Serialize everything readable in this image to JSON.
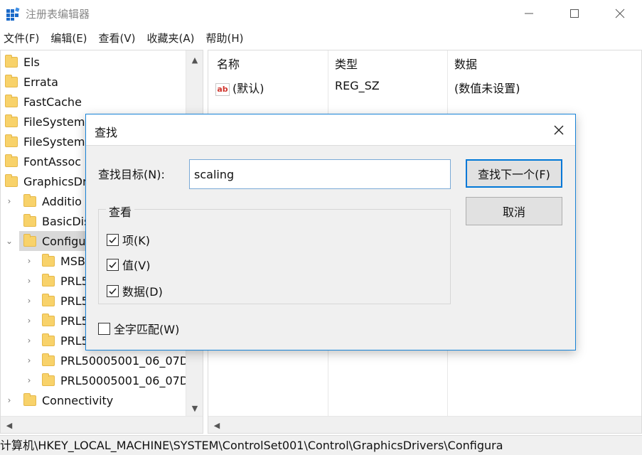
{
  "app": {
    "title": "注册表编辑器"
  },
  "menu": [
    "文件(F)",
    "编辑(E)",
    "查看(V)",
    "收藏夹(A)",
    "帮助(H)"
  ],
  "tree": {
    "items": [
      {
        "label": "Els"
      },
      {
        "label": "Errata"
      },
      {
        "label": "FastCache"
      },
      {
        "label": "FileSystem"
      },
      {
        "label": "FileSystemU"
      },
      {
        "label": "FontAssoc"
      },
      {
        "label": "GraphicsDr"
      },
      {
        "label": "Additio"
      },
      {
        "label": "BasicDis"
      },
      {
        "label": "Configu"
      },
      {
        "label": "MSBD"
      },
      {
        "label": "PRL5"
      },
      {
        "label": "PRL5"
      },
      {
        "label": "PRL5"
      },
      {
        "label": "PRL5"
      },
      {
        "label": "PRL50005001_06_07D"
      },
      {
        "label": "PRL50005001_06_07D"
      },
      {
        "label": "Connectivity"
      }
    ]
  },
  "list": {
    "columns": [
      "名称",
      "类型",
      "数据"
    ],
    "rows": [
      {
        "name": "(默认)",
        "type": "REG_SZ",
        "data": "(数值未设置)"
      }
    ]
  },
  "status": {
    "path": "计算机\\HKEY_LOCAL_MACHINE\\SYSTEM\\ControlSet001\\Control\\GraphicsDrivers\\Configura"
  },
  "find_dialog": {
    "title": "查找",
    "target_label": "查找目标(N):",
    "target_value": "scaling",
    "find_next_label": "查找下一个(F)",
    "cancel_label": "取消",
    "look_at_label": "查看",
    "opt_keys": "项(K)",
    "opt_values": "值(V)",
    "opt_data": "数据(D)",
    "opt_whole": "全字匹配(W)",
    "checked": {
      "keys": true,
      "values": true,
      "data": true,
      "whole": false
    }
  },
  "colors": {
    "accent": "#0078d7",
    "folder": "#f8d26a",
    "dialog_bg": "#f0f0f0"
  }
}
